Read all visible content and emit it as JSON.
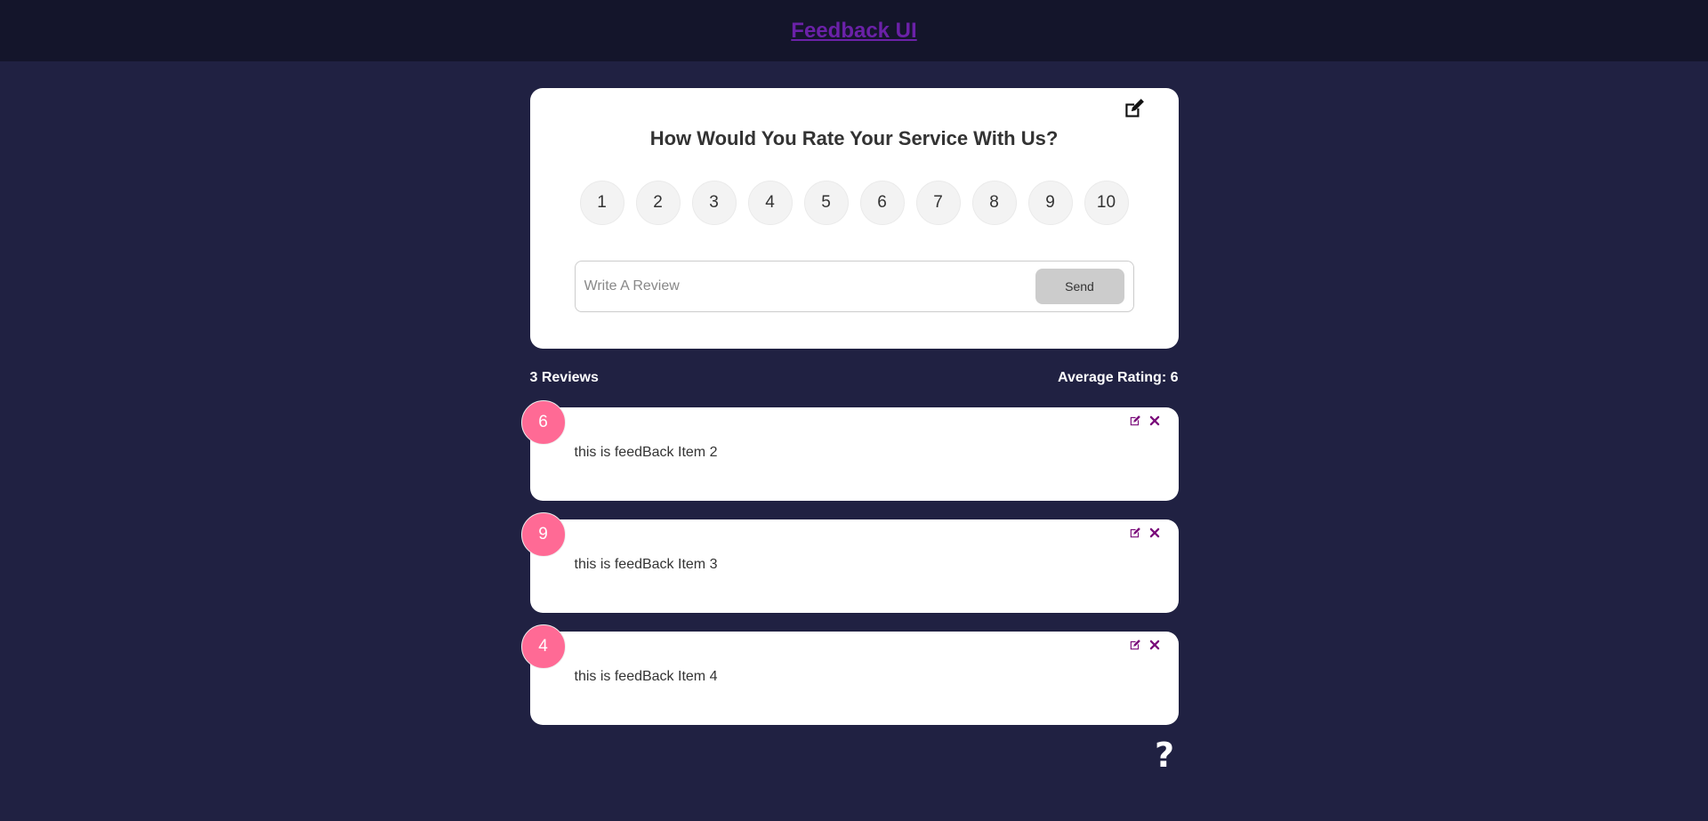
{
  "header": {
    "title": "Feedback UI"
  },
  "rating_card": {
    "question": "How Would You Rate Your Service With Us?",
    "options": [
      "1",
      "2",
      "3",
      "4",
      "5",
      "6",
      "7",
      "8",
      "9",
      "10"
    ],
    "review_placeholder": "Write A Review",
    "send_label": "Send"
  },
  "stats": {
    "reviews_label": "3 Reviews",
    "average_label": "Average Rating: 6"
  },
  "feedback_items": [
    {
      "rating": "6",
      "text": "this is feedBack Item 2"
    },
    {
      "rating": "9",
      "text": "this is feedBack Item 3"
    },
    {
      "rating": "4",
      "text": "this is feedBack Item 4"
    }
  ],
  "help": {
    "icon": "question-icon",
    "glyph": "?"
  },
  "colors": {
    "background": "#202142",
    "header_bg": "#14152b",
    "title": "#6b21a8",
    "badge": "#ff6a95",
    "action_icon": "#7a0a7a"
  }
}
